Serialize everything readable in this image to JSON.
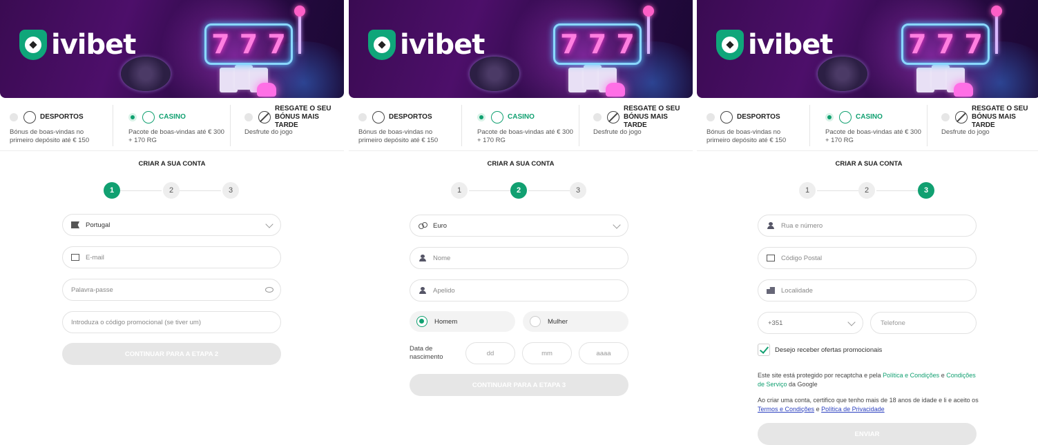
{
  "brand": {
    "name": "ivibet",
    "slot_symbols": [
      "7",
      "7",
      "7"
    ]
  },
  "bonus_options": [
    {
      "title": "DESPORTOS",
      "desc": "Bónus de boas-vindas no primeiro depósito até € 150"
    },
    {
      "title": "CASINO",
      "desc": "Pacote de boas-vindas até € 300 + 170 RG"
    },
    {
      "title": "RESGATE O SEU BÓNUS MAIS TARDE",
      "desc": "Desfrute do jogo"
    }
  ],
  "selected_bonus": "CASINO",
  "form_title": "CRIAR A SUA CONTA",
  "steps": [
    "1",
    "2",
    "3"
  ],
  "step1": {
    "country": "Portugal",
    "email_placeholder": "E-mail",
    "password_placeholder": "Palavra-passe",
    "promo_placeholder": "Introduza o código promocional (se tiver um)",
    "continue_label": "CONTINUAR PARA A ETAPA 2"
  },
  "step2": {
    "currency": "Euro",
    "name_placeholder": "Nome",
    "surname_placeholder": "Apelido",
    "gender_male": "Homem",
    "gender_female": "Mulher",
    "selected_gender": "Homem",
    "dob_label": "Data de nascimento",
    "dob_day": "dd",
    "dob_month": "mm",
    "dob_year": "aaaa",
    "continue_label": "CONTINUAR PARA A ETAPA 3"
  },
  "step3": {
    "street_placeholder": "Rua e número",
    "postal_placeholder": "Código Postal",
    "city_placeholder": "Localidade",
    "phone_code": "+351",
    "phone_placeholder": "Telefone",
    "promo_optin_label": "Desejo receber ofertas promocionais",
    "promo_optin_checked": true,
    "recaptcha_pre": "Este site está protegido por recaptcha e pela",
    "recaptcha_link1": "Política e Condições",
    "recaptcha_and": "e",
    "recaptcha_link2": "Condições de Serviço",
    "recaptcha_post": "da Google",
    "terms_pre": "Ao criar uma conta, certifico que tenho mais de 18 anos de idade e li e aceito os",
    "terms_link1": "Termos e Condições",
    "terms_and": "e",
    "terms_link2": "Política de Privacidade",
    "submit_label": "ENVIAR"
  },
  "colors": {
    "accent": "#11a071",
    "banner": "#3a0b52",
    "disabled_button": "#e6e6e6"
  }
}
